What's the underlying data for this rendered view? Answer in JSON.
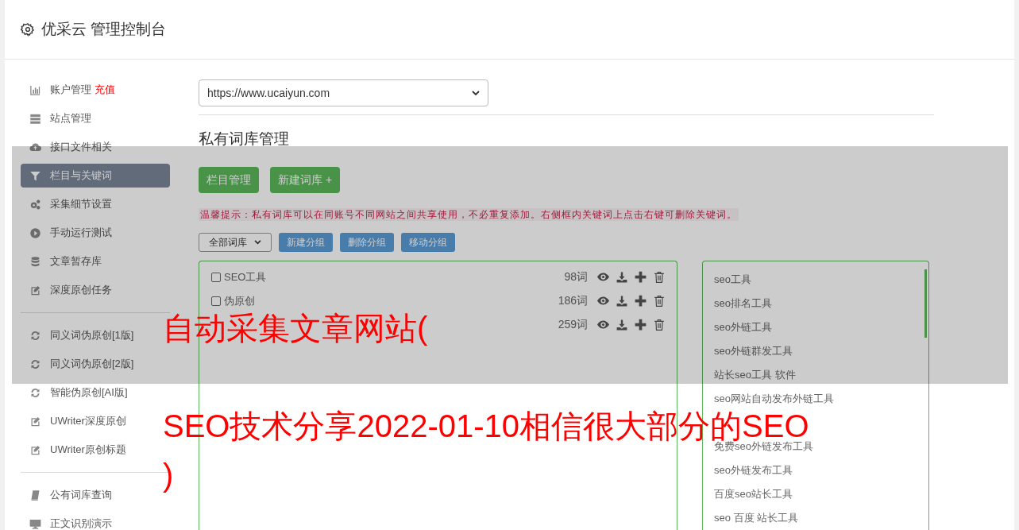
{
  "header": {
    "title": "优采云 管理控制台"
  },
  "sidebar": {
    "groups": [
      {
        "items": [
          {
            "label": "账户管理",
            "badge": "充值",
            "selected": false
          },
          {
            "label": "站点管理",
            "selected": false
          },
          {
            "label": "接口文件相关",
            "selected": false
          },
          {
            "label": "栏目与关键词",
            "selected": true
          },
          {
            "label": "采集细节设置",
            "selected": false
          },
          {
            "label": "手动运行测试",
            "selected": false
          },
          {
            "label": "文章暂存库",
            "selected": false
          },
          {
            "label": "深度原创任务",
            "selected": false
          }
        ]
      },
      {
        "items": [
          {
            "label": "同义词伪原创[1版]",
            "selected": false
          },
          {
            "label": "同义词伪原创[2版]",
            "selected": false
          },
          {
            "label": "智能伪原创[AI版]",
            "selected": false
          },
          {
            "label": "UWriter深度原创",
            "selected": false
          },
          {
            "label": "UWriter原创标题",
            "selected": false
          }
        ]
      },
      {
        "items": [
          {
            "label": "公有词库查询",
            "selected": false
          },
          {
            "label": "正文识别演示",
            "selected": false
          }
        ]
      }
    ]
  },
  "site_select": {
    "value": "https://www.ucaiyun.com"
  },
  "heading": "私有词库管理",
  "buttons": [
    "栏目管理",
    "新建词库 +"
  ],
  "tip": "温馨提示：私有词库可以在同账号不同网站之间共享使用，不必重复添加。右侧框内关键词上点击右键可删除关键词。",
  "group_select": {
    "value": "全部词库"
  },
  "group_buttons": [
    "新建分组",
    "删除分组",
    "移动分组"
  ],
  "libraries": [
    {
      "name": "SEO工具",
      "count": "98词",
      "checked": false
    },
    {
      "name": "伪原创",
      "count": "186词",
      "checked": false
    },
    {
      "count": "259词"
    }
  ],
  "keywords": [
    "seo工具",
    "seo排名工具",
    "seo外链工具",
    "seo外链群发工具",
    "站长seo工具 软件",
    "seo网站自动发布外链工具"
  ],
  "keywords_below_overlay": [
    "免费seo外链发布工具",
    "seo外链发布工具",
    "百度seo站长工具",
    "seo 百度 站长工具"
  ],
  "overlay": {
    "title": "自动采集文章网站(",
    "subtitle": [
      "SEO技术分享2022-01-10相信很大部分的SEO",
      ")"
    ]
  }
}
